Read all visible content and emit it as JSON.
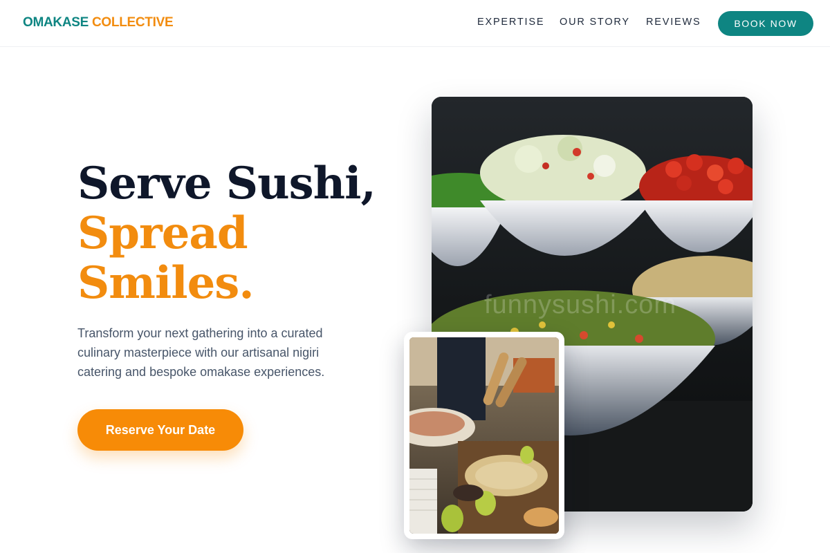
{
  "brand": {
    "part1": "OMAKASE",
    "part2": "COLLECTIVE"
  },
  "nav": {
    "items": [
      "EXPERTISE",
      "OUR STORY",
      "REVIEWS"
    ],
    "cta": "BOOK NOW"
  },
  "hero": {
    "line1": "Serve Sushi,",
    "line2": "Spread",
    "line3": "Smiles.",
    "description": "Transform your next gathering into a curated culinary masterpiece with our artisanal nigiri catering and bespoke omakase experiences.",
    "cta": "Reserve Your Date"
  },
  "images": {
    "main_watermark": "funnysushi.com",
    "main_icon": "salad-bowls-photo",
    "inset_icon": "buffet-table-photo"
  },
  "colors": {
    "teal": "#0e8582",
    "orange": "#f28c0f",
    "navy": "#0f172a",
    "body_text": "#475569"
  }
}
